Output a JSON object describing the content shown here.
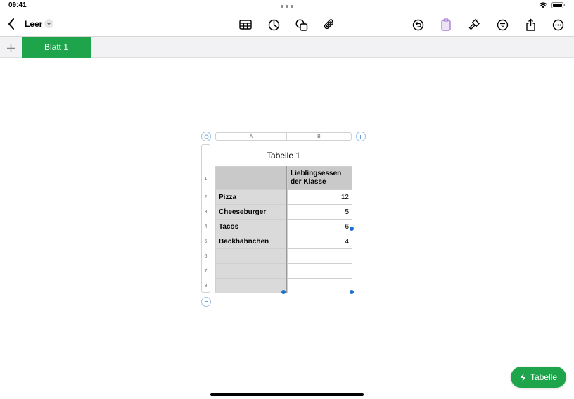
{
  "status": {
    "time": "09:41"
  },
  "toolbar": {
    "doc_title": "Leer",
    "icons": [
      "table-icon",
      "chart-icon",
      "shapes-icon",
      "attachment-icon",
      "undo-icon",
      "clipboard-icon",
      "format-brush-icon",
      "filter-icon",
      "share-icon",
      "more-icon"
    ]
  },
  "sheets": {
    "active_tab": "Blatt 1"
  },
  "table": {
    "title": "Tabelle 1",
    "column_headers": [
      "A",
      "B"
    ],
    "row_numbers": [
      "1",
      "2",
      "3",
      "4",
      "5",
      "6",
      "7",
      "8"
    ],
    "header": {
      "a": "",
      "b_line1": "Lieblingsessen",
      "b_line2": "der Klasse"
    },
    "rows": [
      {
        "name": "Pizza",
        "value": "12"
      },
      {
        "name": "Cheeseburger",
        "value": "5"
      },
      {
        "name": "Tacos",
        "value": "6"
      },
      {
        "name": "Backhähnchen",
        "value": "4"
      },
      {
        "name": "",
        "value": ""
      },
      {
        "name": "",
        "value": ""
      },
      {
        "name": "",
        "value": ""
      }
    ]
  },
  "fab": {
    "label": "Tabelle"
  },
  "colors": {
    "accent": "#1ea54c",
    "selection": "#1b6fd4"
  }
}
